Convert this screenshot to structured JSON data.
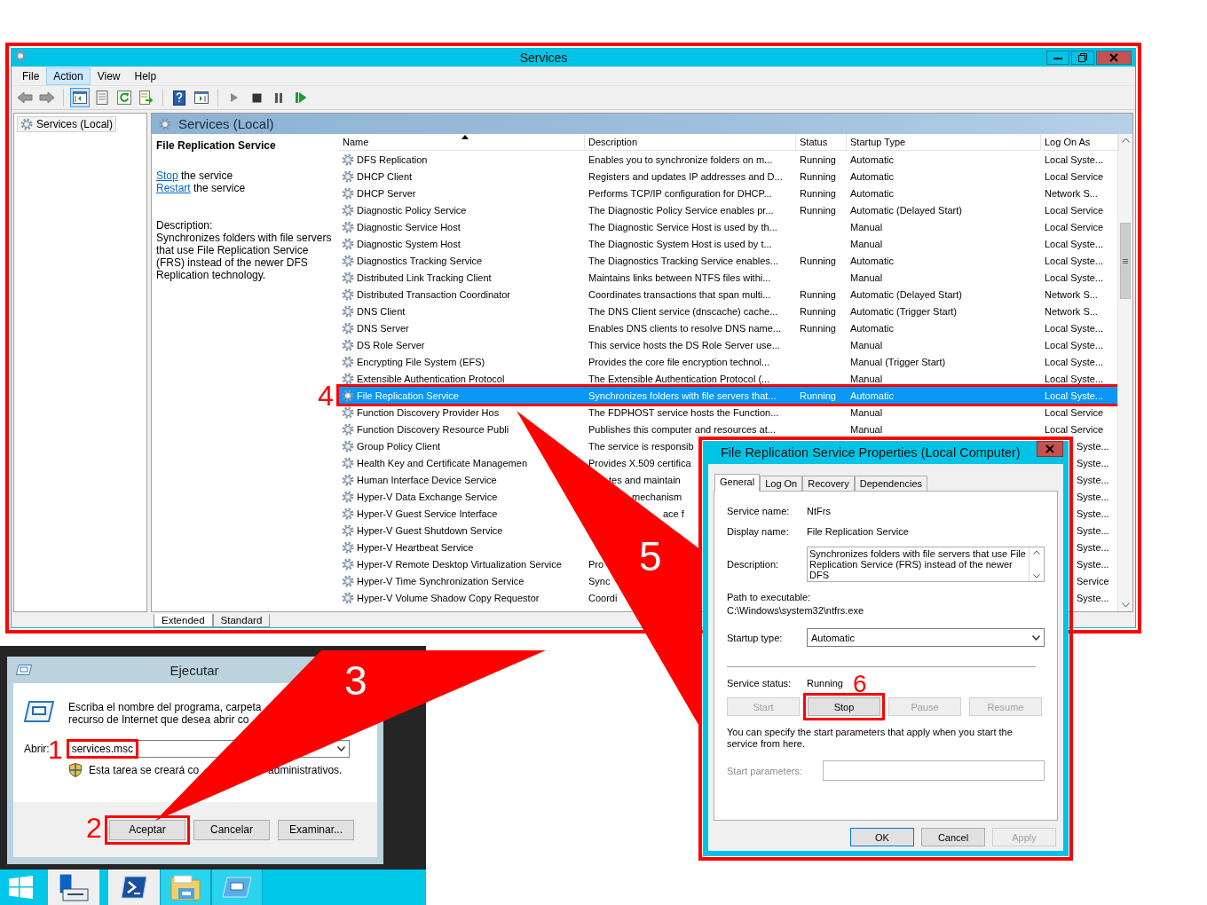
{
  "services_window": {
    "title": "Services",
    "menu": [
      {
        "label": "File",
        "selected": false
      },
      {
        "label": "Action",
        "selected": true
      },
      {
        "label": "View",
        "selected": false
      },
      {
        "label": "Help",
        "selected": false
      }
    ],
    "toolbar_groups": [
      {
        "buttons": [
          {
            "kind": "back",
            "pressed": false
          },
          {
            "kind": "forward",
            "pressed": false
          }
        ]
      },
      {
        "buttons": [
          {
            "kind": "tree",
            "pressed": true
          },
          {
            "kind": "properties",
            "pressed": false
          },
          {
            "kind": "refresh",
            "pressed": false
          },
          {
            "kind": "export",
            "pressed": false
          }
        ]
      },
      {
        "buttons": [
          {
            "kind": "help",
            "pressed": false
          },
          {
            "kind": "pane",
            "pressed": false
          }
        ]
      },
      {
        "buttons": [
          {
            "kind": "start",
            "pressed": false
          },
          {
            "kind": "stop",
            "pressed": false
          },
          {
            "kind": "pause",
            "pressed": false
          },
          {
            "kind": "restart",
            "pressed": false
          }
        ]
      }
    ],
    "tree": [
      {
        "label": "Services (Local)",
        "selected": true
      }
    ],
    "panel_title": "Services (Local)",
    "details": {
      "title": "File Replication Service",
      "actions": [
        {
          "link": "Stop",
          "text": "the service"
        },
        {
          "link": "Restart",
          "text": "the service"
        }
      ],
      "description_label": "Description:",
      "description": "Synchronizes folders with file servers that use File Replication Service (FRS) instead of the newer DFS Replication technology."
    },
    "columns": [
      {
        "label": "Name",
        "sorted": true
      },
      {
        "label": "Description",
        "sorted": false
      },
      {
        "label": "Status",
        "sorted": false
      },
      {
        "label": "Startup Type",
        "sorted": false
      },
      {
        "label": "Log On As",
        "sorted": false
      }
    ],
    "rows": [
      {
        "name": "DFS Replication",
        "description": "Enables you to synchronize folders on m...",
        "status": "Running",
        "startup": "Automatic",
        "logon": "Local Syste...",
        "selected": false
      },
      {
        "name": "DHCP Client",
        "description": "Registers and updates IP addresses and D...",
        "status": "Running",
        "startup": "Automatic",
        "logon": "Local Service",
        "selected": false
      },
      {
        "name": "DHCP Server",
        "description": "Performs TCP/IP configuration for DHCP...",
        "status": "Running",
        "startup": "Automatic",
        "logon": "Network S...",
        "selected": false
      },
      {
        "name": "Diagnostic Policy Service",
        "description": "The Diagnostic Policy Service enables pr...",
        "status": "Running",
        "startup": "Automatic (Delayed Start)",
        "logon": "Local Service",
        "selected": false
      },
      {
        "name": "Diagnostic Service Host",
        "description": "The Diagnostic Service Host is used by th...",
        "startup": "Manual",
        "logon": "Local Service",
        "selected": false
      },
      {
        "name": "Diagnostic System Host",
        "description": "The Diagnostic System Host is used by t...",
        "startup": "Manual",
        "logon": "Local Syste...",
        "selected": false
      },
      {
        "name": "Diagnostics Tracking Service",
        "description": "The Diagnostics Tracking Service enables...",
        "status": "Running",
        "startup": "Automatic",
        "logon": "Local Syste...",
        "selected": false
      },
      {
        "name": "Distributed Link Tracking Client",
        "description": "Maintains links between NTFS files withi...",
        "startup": "Manual",
        "logon": "Local Syste...",
        "selected": false
      },
      {
        "name": "Distributed Transaction Coordinator",
        "description": "Coordinates transactions that span multi...",
        "status": "Running",
        "startup": "Automatic (Delayed Start)",
        "logon": "Network S...",
        "selected": false
      },
      {
        "name": "DNS Client",
        "description": "The DNS Client service (dnscache) cache...",
        "status": "Running",
        "startup": "Automatic (Trigger Start)",
        "logon": "Network S...",
        "selected": false
      },
      {
        "name": "DNS Server",
        "description": "Enables DNS clients to resolve DNS name...",
        "status": "Running",
        "startup": "Automatic",
        "logon": "Local Syste...",
        "selected": false
      },
      {
        "name": "DS Role Server",
        "description": "This service hosts the DS Role Server use...",
        "startup": "Manual",
        "logon": "Local Syste...",
        "selected": false
      },
      {
        "name": "Encrypting File System (EFS)",
        "description": "Provides the core file encryption technol...",
        "startup": "Manual (Trigger Start)",
        "logon": "Local Syste...",
        "selected": false
      },
      {
        "name": "Extensible Authentication Protocol",
        "description": "The Extensible Authentication Protocol (...",
        "startup": "Manual",
        "logon": "Local Syste...",
        "selected": false
      },
      {
        "name": "File Replication Service",
        "description": "Synchronizes folders with file servers that...",
        "status": "Running",
        "startup": "Automatic",
        "logon": "Local Syste...",
        "selected": true
      },
      {
        "name": "Function Discovery Provider Hos",
        "description": "The FDPHOST service hosts the Function...",
        "startup": "Manual",
        "logon": "Local Service",
        "selected": false
      },
      {
        "name": "Function Discovery Resource Publi",
        "description": "Publishes this computer and resources at...",
        "startup": "Manual",
        "logon": "Local Service",
        "selected": false
      },
      {
        "name": "Group Policy Client",
        "description": "The service is responsib",
        "logon": "Syste...",
        "selected": false
      },
      {
        "name": "Health Key and Certificate Managemen",
        "description": "Provides X.509 certifica",
        "logon": "Syste...",
        "selected": false
      },
      {
        "name": "Human Interface Device Service",
        "description": "tes and maintain",
        "logon": "Syste...",
        "selected": false
      },
      {
        "name": "Hyper-V Data Exchange Service",
        "description": "mechanism",
        "logon": "Syste...",
        "selected": false
      },
      {
        "name": "Hyper-V Guest Service Interface",
        "description": "ace f",
        "logon": "Syste...",
        "selected": false
      },
      {
        "name": "Hyper-V Guest Shutdown Service",
        "logon": "Syste...",
        "selected": false
      },
      {
        "name": "Hyper-V Heartbeat Service",
        "logon": "Syste...",
        "selected": false
      },
      {
        "name": "Hyper-V Remote Desktop Virtualization Service",
        "description": "Pro",
        "logon": "Syste...",
        "selected": false
      },
      {
        "name": "Hyper-V Time Synchronization Service",
        "description": "Sync",
        "logon": "Service",
        "selected": false
      },
      {
        "name": "Hyper-V Volume Shadow Copy Requestor",
        "description": "Coordi",
        "logon": "Syste...",
        "selected": false
      }
    ],
    "view_tabs": [
      {
        "label": "Extended",
        "selected": true
      },
      {
        "label": "Standard",
        "selected": false
      }
    ]
  },
  "properties_dialog": {
    "title": "File Replication Service Properties (Local Computer)",
    "tabs": [
      {
        "label": "General",
        "selected": true
      },
      {
        "label": "Log On",
        "selected": false
      },
      {
        "label": "Recovery",
        "selected": false
      },
      {
        "label": "Dependencies",
        "selected": false
      }
    ],
    "service_name_label": "Service name:",
    "service_name": "NtFrs",
    "display_name_label": "Display name:",
    "display_name": "File Replication Service",
    "description_label": "Description:",
    "description": "Synchronizes folders with file servers that use File Replication Service (FRS) instead of the newer DFS",
    "path_label": "Path to executable:",
    "path": "C:\\Windows\\system32\\ntfrs.exe",
    "startup_type_label": "Startup type:",
    "startup_type": "Automatic",
    "status_label": "Service status:",
    "status": "Running",
    "service_buttons": [
      {
        "label": "Start",
        "disabled": true
      },
      {
        "label": "Stop",
        "disabled": false
      },
      {
        "label": "Pause",
        "disabled": true
      },
      {
        "label": "Resume",
        "disabled": true
      }
    ],
    "hint": "You can specify the start parameters that apply when you start the service from here.",
    "start_parameters": {
      "label": "Start parameters:",
      "disabled": true
    },
    "buttons": [
      {
        "label": "OK",
        "default": true,
        "disabled": false
      },
      {
        "label": "Cancel",
        "default": false,
        "disabled": false
      },
      {
        "label": "Apply",
        "default": false,
        "disabled": true
      }
    ]
  },
  "run_dialog": {
    "title": "Ejecutar",
    "prompt_lines": [
      "Escriba el nombre del programa, carpeta",
      "recurso de Internet que desea abrir co"
    ],
    "open_label": "Abrir:",
    "command": "services.msc",
    "admin_note_parts": [
      "Esta tarea se creará co",
      "administrativos."
    ],
    "buttons": [
      {
        "label": "Aceptar"
      },
      {
        "label": "Cancelar"
      },
      {
        "label": "Examinar..."
      }
    ]
  },
  "taskbar": [
    {
      "kind": "start",
      "open": false
    },
    {
      "kind": "server-manager",
      "open": false
    },
    {
      "kind": "powershell",
      "open": false
    },
    {
      "kind": "explorer",
      "open": true
    },
    {
      "kind": "run",
      "open": true
    }
  ],
  "annotations": [
    {
      "label": "1"
    },
    {
      "label": "2"
    },
    {
      "label": "3"
    },
    {
      "label": "4"
    },
    {
      "label": "5"
    },
    {
      "label": "6"
    }
  ]
}
